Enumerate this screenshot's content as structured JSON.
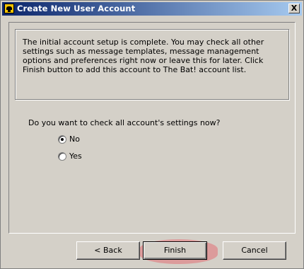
{
  "window": {
    "title": "Create New User Account",
    "close_label": "X"
  },
  "info": {
    "text": "The initial account setup is complete. You may check all other settings such as message templates, message management options and preferences right now or leave this for later. Click Finish button to add this account to The Bat! account list."
  },
  "question": {
    "text": "Do you want to check all account's settings now?"
  },
  "options": [
    {
      "label": "No",
      "checked": true
    },
    {
      "label": "Yes",
      "checked": false
    }
  ],
  "buttons": {
    "back": "< Back",
    "finish": "Finish",
    "cancel": "Cancel"
  },
  "colors": {
    "title_start": "#0a246a",
    "title_end": "#a6caf0",
    "dialog_bg": "#d4d0c8",
    "click_highlight": "#e65a64"
  },
  "icons": {
    "app": "the-bat-icon",
    "close": "close-icon"
  }
}
